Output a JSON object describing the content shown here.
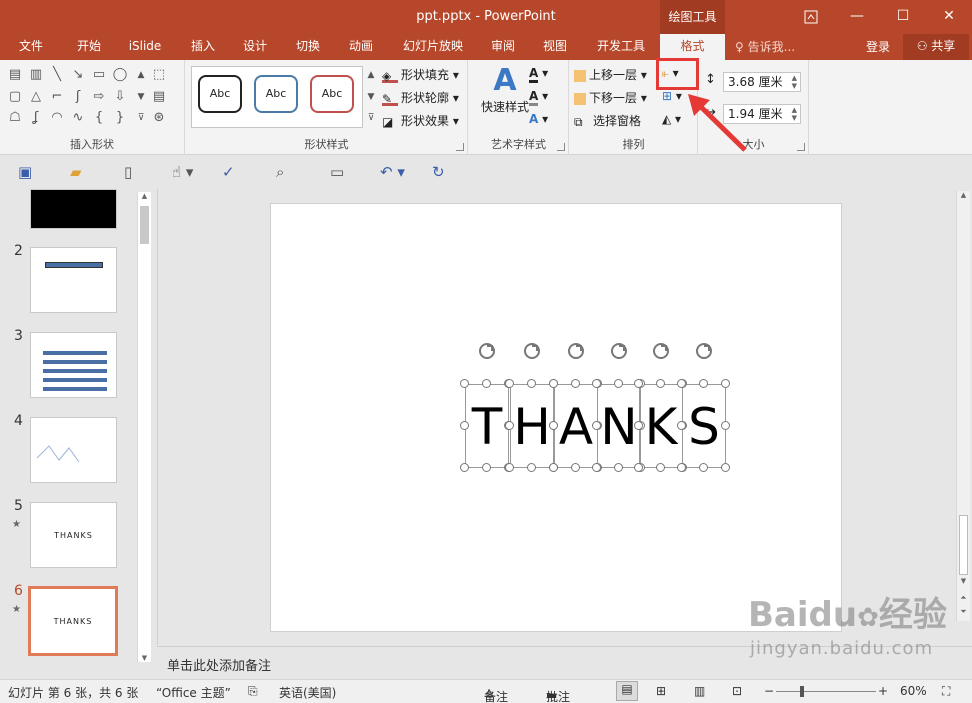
{
  "window": {
    "title": "ppt.pptx - PowerPoint",
    "context_tab": "绘图工具",
    "controls": [
      "restore-ribbon",
      "minimize",
      "maximize",
      "close"
    ]
  },
  "tabs": [
    "文件",
    "开始",
    "iSlide",
    "插入",
    "设计",
    "切换",
    "动画",
    "幻灯片放映",
    "审阅",
    "视图",
    "开发工具",
    "格式"
  ],
  "active_tab": "格式",
  "tell_me": "告诉我...",
  "login": "登录",
  "share": "共享",
  "ribbon": {
    "groups": {
      "insert_shapes": "插入形状",
      "shape_styles": "形状样式",
      "wordart": "艺术字样式",
      "arrange": "排列",
      "size": "大小"
    },
    "style_sample": "Abc",
    "shape_fill": "形状填充",
    "shape_outline": "形状轮廓",
    "shape_effects": "形状效果",
    "quick_styles": "快速样式",
    "bring_forward": "上移一层",
    "send_backward": "下移一层",
    "selection_pane": "选择窗格",
    "height": "3.68 厘米",
    "width": "1.94 厘米"
  },
  "thumbnails": {
    "numbers": [
      "2",
      "3",
      "4",
      "5",
      "6"
    ],
    "thanks": "THANKS",
    "star": "★"
  },
  "slide": {
    "letters": [
      "T",
      "H",
      "A",
      "N",
      "K",
      "S"
    ]
  },
  "notes_placeholder": "单击此处添加备注",
  "status": {
    "slide_info": "幻灯片 第 6 张，共 6 张",
    "theme": "“Office 主题”",
    "language": "英语(美国)",
    "notes": "备注",
    "comments": "批注",
    "zoom": "60%"
  },
  "watermark": {
    "brand": "Baidu",
    "brand_cn": "经验",
    "url": "jingyan.baidu.com"
  },
  "colors": {
    "accent": "#b7472a",
    "highlight": "#e53935"
  }
}
